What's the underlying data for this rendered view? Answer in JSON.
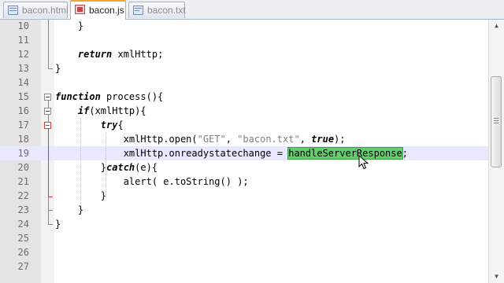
{
  "tabs": [
    {
      "label": "bacon.html",
      "icon": "html-file-icon",
      "active": false
    },
    {
      "label": "bacon.js",
      "icon": "js-file-icon",
      "active": true
    },
    {
      "label": "bacon.txt",
      "icon": "text-file-icon",
      "active": false
    }
  ],
  "editor": {
    "current_line": 19,
    "selection": "handleServerResponse",
    "lines": [
      {
        "n": "10",
        "segs": [
          "    }"
        ]
      },
      {
        "n": "11",
        "segs": [
          ""
        ]
      },
      {
        "n": "12",
        "segs": [
          "    ",
          "return",
          " xmlHttp;"
        ]
      },
      {
        "n": "13",
        "segs": [
          "}"
        ]
      },
      {
        "n": "14",
        "segs": [
          ""
        ]
      },
      {
        "n": "15",
        "segs": [
          "function",
          " process(){"
        ]
      },
      {
        "n": "16",
        "segs": [
          "    ",
          "if",
          "(xmlHttp){"
        ]
      },
      {
        "n": "17",
        "segs": [
          "        ",
          "try",
          "{"
        ]
      },
      {
        "n": "18",
        "segs": [
          "            xmlHttp.open(",
          "\"GET\"",
          ", ",
          "\"bacon.txt\"",
          ", ",
          "true",
          ");"
        ]
      },
      {
        "n": "19",
        "segs": [
          "            xmlHttp.onreadystatechange = ",
          "handleServerResponse",
          ";"
        ]
      },
      {
        "n": "20",
        "segs": [
          "        }",
          "catch",
          "(e){"
        ]
      },
      {
        "n": "21",
        "segs": [
          "            alert( e.toString() );"
        ]
      },
      {
        "n": "22",
        "segs": [
          "        }"
        ]
      },
      {
        "n": "23",
        "segs": [
          "    }"
        ]
      },
      {
        "n": "24",
        "segs": [
          "}"
        ]
      },
      {
        "n": "25",
        "segs": [
          ""
        ]
      },
      {
        "n": "26",
        "segs": [
          ""
        ]
      },
      {
        "n": "27",
        "segs": [
          ""
        ]
      }
    ]
  },
  "scrollbar": {
    "up": "▲",
    "down": "▼"
  },
  "colors": {
    "selection": "#63cf6a",
    "current_line": "#e8e8ff",
    "fold_active": "#d63a3a",
    "active_tab_accent": "#f0a535"
  }
}
